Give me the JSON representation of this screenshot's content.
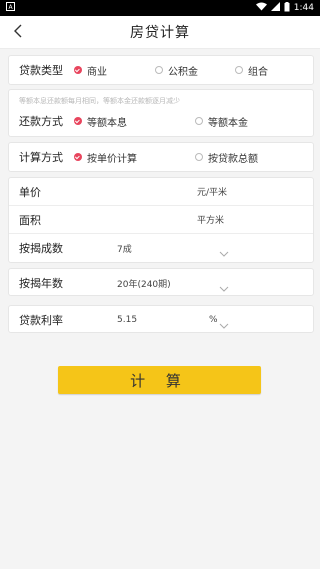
{
  "status": {
    "time": "1:44",
    "left_icon": "a-icon",
    "icons": [
      "wifi-icon",
      "signal-icon",
      "battery-icon"
    ]
  },
  "header": {
    "title": "房贷计算",
    "back_icon": "chevron-left-icon"
  },
  "loan_type": {
    "label": "贷款类型",
    "options": [
      {
        "label": "商业",
        "checked": true
      },
      {
        "label": "公积金",
        "checked": false
      },
      {
        "label": "组合",
        "checked": false
      }
    ]
  },
  "repay": {
    "hint": "等额本息还款额每月相同，等额本金还款额逐月减少",
    "label": "还款方式",
    "options": [
      {
        "label": "等额本息",
        "checked": true
      },
      {
        "label": "等额本金",
        "checked": false
      }
    ]
  },
  "calc_method": {
    "label": "计算方式",
    "options": [
      {
        "label": "按单价计算",
        "checked": true
      },
      {
        "label": "按贷款总额",
        "checked": false
      }
    ]
  },
  "fields": {
    "unit_price": {
      "label": "单价",
      "unit": "元/平米"
    },
    "area": {
      "label": "面积",
      "unit": "平方米"
    },
    "mortgage_ratio": {
      "label": "按揭成数",
      "value": "7成"
    }
  },
  "years": {
    "label": "按揭年数",
    "value": "20年(240期)"
  },
  "rate": {
    "label": "贷款利率",
    "value": "5.15",
    "unit": "%"
  },
  "calculate_button": "计 算",
  "colors": {
    "accent": "#e8455d",
    "button": "#f5c518"
  }
}
